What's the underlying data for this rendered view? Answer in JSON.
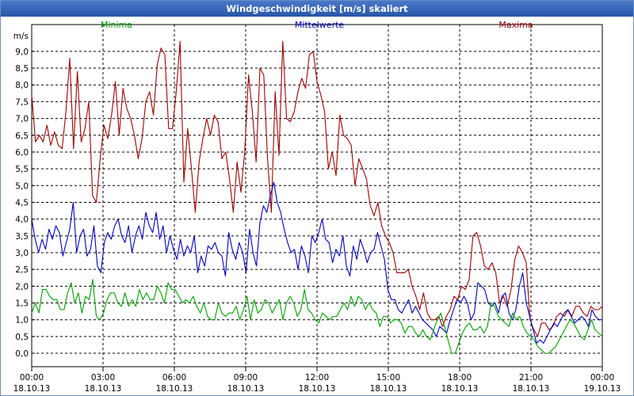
{
  "window": {
    "title": "Windgeschwindigkeit [m/s] skaliert"
  },
  "chart_data": {
    "type": "line",
    "title": "Windgeschwindigkeit [m/s] skaliert",
    "ylabel": "m/s",
    "xlabel": "",
    "ylim": [
      -0.4,
      9.8
    ],
    "xlim": [
      0,
      24
    ],
    "grid": true,
    "legend_position": "top",
    "y_ticks": [
      "0,0",
      "0,5",
      "1,0",
      "1,5",
      "2,0",
      "2,5",
      "3,0",
      "3,5",
      "4,0",
      "4,5",
      "5,0",
      "5,5",
      "6,0",
      "6,5",
      "7,0",
      "7,5",
      "8,0",
      "8,5",
      "9,0"
    ],
    "x_ticks": [
      {
        "time": "00:00",
        "date": "18.10.13"
      },
      {
        "time": "03:00",
        "date": "18.10.13"
      },
      {
        "time": "06:00",
        "date": "18.10.13"
      },
      {
        "time": "09:00",
        "date": "18.10.13"
      },
      {
        "time": "12:00",
        "date": "18.10.13"
      },
      {
        "time": "15:00",
        "date": "18.10.13"
      },
      {
        "time": "18:00",
        "date": "18.10.13"
      },
      {
        "time": "21:00",
        "date": "18.10.13"
      },
      {
        "time": "00:00",
        "date": "19.10.13"
      }
    ],
    "x_hours": [
      0,
      0.2,
      0.4,
      0.6,
      0.8,
      1.0,
      1.2,
      1.4,
      1.6,
      1.8,
      2.0,
      2.2,
      2.4,
      2.6,
      2.8,
      3.0,
      3.2,
      3.4,
      3.6,
      3.8,
      4.0,
      4.2,
      4.4,
      4.6,
      4.8,
      5.0,
      5.2,
      5.4,
      5.6,
      5.8,
      6.0,
      6.2,
      6.4,
      6.6,
      6.8,
      7.0,
      7.2,
      7.4,
      7.6,
      7.8,
      8.0,
      8.2,
      8.4,
      8.6,
      8.8,
      9.0,
      9.2,
      9.4,
      9.6,
      9.8,
      10.0,
      10.2,
      10.4,
      10.6,
      10.8,
      11.0,
      11.2,
      11.4,
      11.6,
      11.8,
      12.0,
      12.2,
      12.4,
      12.6,
      12.8,
      13.0,
      13.2,
      13.4,
      13.6,
      13.8,
      14.0,
      14.2,
      14.4,
      14.6,
      14.8,
      15.0,
      15.2,
      15.4,
      15.6,
      15.8,
      16.0,
      16.2,
      16.4,
      16.6,
      16.8,
      17.0,
      17.2,
      17.4,
      17.6,
      17.8,
      18.0,
      18.2,
      18.4,
      18.6,
      18.8,
      19.0,
      19.2,
      19.4,
      19.6,
      19.8,
      20.0,
      20.2,
      20.4,
      20.6,
      20.8,
      21.0,
      21.2,
      21.4,
      21.6,
      21.8,
      22.0,
      22.2,
      22.4,
      22.6,
      22.8,
      23.0,
      23.2,
      23.4,
      23.6,
      23.8,
      24.0
    ],
    "series": [
      {
        "name": "Maxima",
        "color": "#a00000",
        "values": [
          7.7,
          6.3,
          6.5,
          6.3,
          6.8,
          6.2,
          6.6,
          6.2,
          6.1,
          7.2,
          8.8,
          6.1,
          8.4,
          6.3,
          6.7,
          7.5,
          4.7,
          4.5,
          5.8,
          6.8,
          6.4,
          7.1,
          8.1,
          6.5,
          7.9,
          7.3,
          7.0,
          6.5,
          5.8,
          6.4,
          7.5,
          7.8,
          7.1,
          8.6,
          9.1,
          8.9,
          6.7,
          6.7,
          7.8,
          9.3,
          5.1,
          6.7,
          5.5,
          4.2,
          5.7,
          6.4,
          7.0,
          6.5,
          7.1,
          6.9,
          5.8,
          6.0,
          5.2,
          4.2,
          5.7,
          4.8,
          6.0,
          8.3,
          7.2,
          5.7,
          8.5,
          8.3,
          5.8,
          4.2,
          7.8,
          5.9,
          9.3,
          7.0,
          6.9,
          7.2,
          7.8,
          8.2,
          7.9,
          8.9,
          9.0,
          8.1,
          7.7,
          7.2,
          5.5,
          6.0,
          5.3,
          7.1,
          6.5,
          6.4,
          6.2,
          5.0,
          5.8,
          5.5,
          5.2,
          4.4,
          4.1,
          4.5,
          3.8,
          3.5,
          3.3,
          3.0,
          2.4,
          2.4,
          2.4,
          2.5,
          2.0,
          1.7,
          1.3,
          1.8,
          1.2,
          1.0,
          1.0,
          1.1,
          0.8,
          1.1,
          1.3,
          1.7,
          1.6,
          2.0,
          1.9,
          2.2,
          3.5,
          3.6,
          3.2,
          2.6,
          2.5,
          2.7,
          2.4,
          1.5,
          1.7,
          1.4,
          1.9,
          2.8,
          3.2,
          3.0,
          2.7,
          1.0,
          0.7,
          0.5,
          0.9,
          0.9,
          0.7,
          0.8,
          1.1,
          1.2,
          1.1,
          1.3,
          1.1,
          1.4,
          1.4,
          1.2,
          1.1,
          1.4,
          1.3,
          1.3,
          1.4
        ],
        "samples": 0
      },
      {
        "name": "Mittelwerte",
        "color": "#0000c0",
        "values": [
          4.0,
          3.4,
          3.0,
          3.4,
          3.1,
          3.7,
          3.4,
          3.8,
          3.6,
          2.9,
          3.3,
          3.7,
          4.5,
          3.0,
          3.5,
          3.7,
          2.9,
          3.1,
          3.8,
          2.6,
          2.4,
          3.3,
          3.6,
          3.4,
          3.8,
          4.0,
          3.5,
          3.3,
          3.8,
          3.0,
          3.5,
          3.8,
          3.4,
          4.2,
          3.8,
          3.6,
          4.2,
          3.4,
          3.8,
          3.0,
          3.5,
          3.1,
          2.8,
          3.4,
          2.9,
          3.2,
          3.0,
          3.5,
          2.4,
          2.9,
          2.6,
          3.2,
          3.1,
          3.3,
          3.0,
          2.9,
          2.3,
          3.6,
          3.1,
          2.8,
          3.3,
          3.0,
          2.4,
          3.7,
          3.0,
          2.6,
          3.9,
          4.4,
          4.2,
          4.7,
          5.1,
          4.5,
          4.2,
          3.7,
          3.3,
          3.0,
          3.1,
          2.5,
          3.2,
          2.9,
          2.4,
          3.5,
          3.3,
          3.6,
          4.0,
          3.4,
          3.3,
          2.7,
          3.1,
          2.9,
          3.5,
          2.6,
          2.3,
          3.2,
          2.8,
          3.4,
          3.1,
          2.7,
          3.0,
          3.1,
          3.6,
          3.2,
          2.8,
          1.9,
          1.6,
          1.6,
          1.3,
          1.2,
          1.4,
          1.6,
          1.2,
          1.4,
          1.2,
          1.0,
          0.9,
          0.8,
          0.7,
          0.5,
          0.8,
          0.7,
          0.6,
          1.0,
          1.3,
          1.6,
          1.5,
          1.7,
          1.5,
          1.0,
          1.2,
          2.1,
          2.0,
          1.9,
          1.5,
          1.4,
          1.5,
          1.2,
          1.7,
          1.8,
          1.2,
          1.0,
          1.3,
          2.0,
          2.4,
          1.5,
          1.1,
          0.7,
          0.3,
          0.4,
          0.3,
          0.5,
          0.7,
          0.9,
          0.8,
          1.0,
          1.2,
          1.3,
          1.1,
          0.9,
          1.0,
          1.1,
          1.0,
          0.8,
          1.3,
          1.1,
          1.0,
          1.0
        ],
        "samples": 0
      },
      {
        "name": "Minima",
        "color": "#00a000",
        "values": [
          1.2,
          1.5,
          1.2,
          1.9,
          1.9,
          1.7,
          1.6,
          1.6,
          1.3,
          1.3,
          1.8,
          2.1,
          1.5,
          1.8,
          1.2,
          1.7,
          1.6,
          2.2,
          1.1,
          1.0,
          1.2,
          1.6,
          1.8,
          1.8,
          1.5,
          1.4,
          1.8,
          1.4,
          1.6,
          1.4,
          1.9,
          1.6,
          1.8,
          1.6,
          1.6,
          2.0,
          1.8,
          1.5,
          2.1,
          1.9,
          1.9,
          1.7,
          1.5,
          1.6,
          1.5,
          1.7,
          1.4,
          1.2,
          1.5,
          1.1,
          1.0,
          1.0,
          1.5,
          1.2,
          1.1,
          1.2,
          1.2,
          1.4,
          1.0,
          1.3,
          1.7,
          1.0,
          1.6,
          1.2,
          1.3,
          1.6,
          1.5,
          1.2,
          1.4,
          1.6,
          1.0,
          1.5,
          1.7,
          1.5,
          1.1,
          1.3,
          1.9,
          1.3,
          1.2,
          1.0,
          0.9,
          1.2,
          1.1,
          1.0,
          1.1,
          1.1,
          1.3,
          1.5,
          1.3,
          1.7,
          1.4,
          1.7,
          1.6,
          1.3,
          1.5,
          1.3,
          1.2,
          0.8,
          1.1,
          1.1,
          0.9,
          1.0,
          1.0,
          0.9,
          0.6,
          0.8,
          0.8,
          0.6,
          0.5,
          0.7,
          0.5,
          0.4,
          0.7,
          1.0,
          1.2,
          0.8,
          0.4,
          0.0,
          0.0,
          0.3,
          0.6,
          0.8,
          0.9,
          0.7,
          0.7,
          0.8,
          0.6,
          0.8,
          1.5,
          1.4,
          1.1,
          1.0,
          0.9,
          0.8,
          1.2,
          1.0,
          1.1,
          0.8,
          0.6,
          0.5,
          0.4,
          0.2,
          0.1,
          0.0,
          0.0,
          0.1,
          0.2,
          0.4,
          0.6,
          0.8,
          1.0,
          0.9,
          0.7,
          0.5,
          0.4,
          0.7,
          1.0,
          0.7,
          0.6,
          0.5
        ],
        "samples": 0
      }
    ]
  }
}
